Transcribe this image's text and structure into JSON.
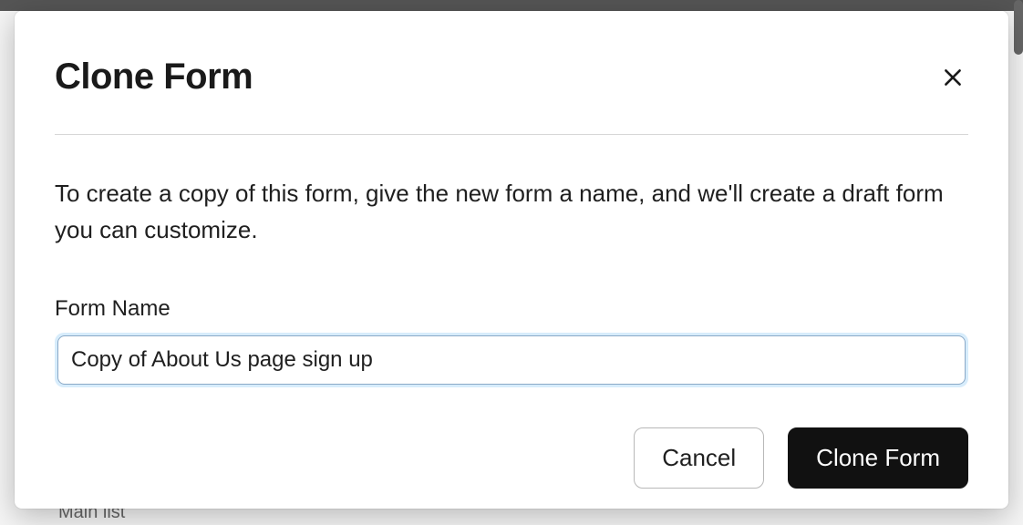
{
  "background": {
    "partial_text": "Main list"
  },
  "modal": {
    "title": "Clone Form",
    "description": "To create a copy of this form, give the new form a name, and we'll create a draft form you can customize.",
    "field_label": "Form Name",
    "form_name_value": "Copy of About Us page sign up",
    "cancel_label": "Cancel",
    "submit_label": "Clone Form"
  }
}
